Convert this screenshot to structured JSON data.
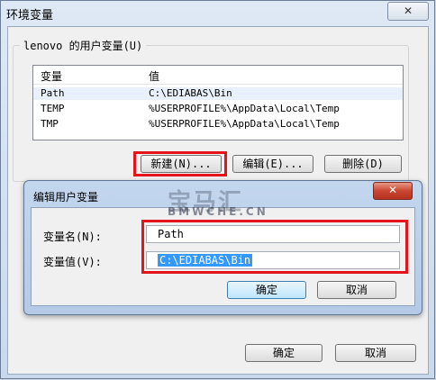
{
  "outer": {
    "title": "环境变量",
    "close_glyph": "✕",
    "ok_label": "确定",
    "cancel_label": "取消"
  },
  "user_vars": {
    "group_label": "lenovo 的用户变量(U)",
    "col_var": "变量",
    "col_val": "值",
    "rows": [
      {
        "name": "Path",
        "value": "C:\\EDIABAS\\Bin"
      },
      {
        "name": "TEMP",
        "value": "%USERPROFILE%\\AppData\\Local\\Temp"
      },
      {
        "name": "TMP",
        "value": "%USERPROFILE%\\AppData\\Local\\Temp"
      }
    ],
    "new_label": "新建(N)...",
    "edit_label": "编辑(E)...",
    "delete_label": "删除(D)"
  },
  "edit_dialog": {
    "title": "编辑用户变量",
    "close_glyph": "✕",
    "name_label": "变量名(N):",
    "name_value": "Path",
    "value_label": "变量值(V):",
    "value_value": "C:\\EDIABAS\\Bin",
    "ok_label": "确定",
    "cancel_label": "取消"
  },
  "watermark": {
    "main": "宝马汇",
    "sub": "BMWCHE.CN"
  },
  "colors": {
    "highlight": "#e4141b",
    "selection": "#3399ff"
  }
}
